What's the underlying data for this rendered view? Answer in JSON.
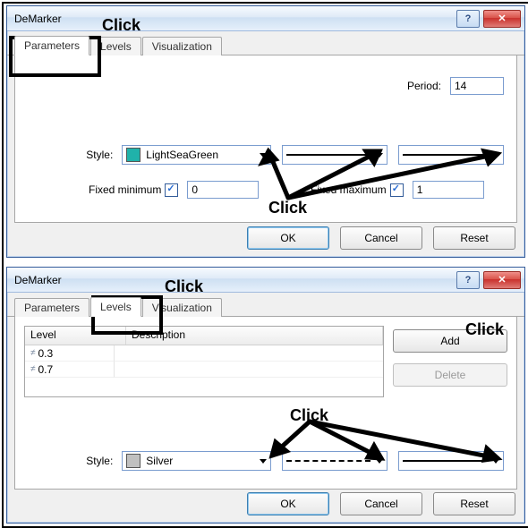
{
  "dialog1": {
    "title": "DeMarker",
    "tabs": {
      "parameters": "Parameters",
      "levels": "Levels",
      "visualization": "Visualization"
    },
    "period_label": "Period:",
    "period_value": "14",
    "style_label": "Style:",
    "style_color_name": "LightSeaGreen",
    "fixed_min_label": "Fixed minimum",
    "fixed_min_value": "0",
    "fixed_max_label": "Fixed maximum",
    "fixed_max_value": "1",
    "buttons": {
      "ok": "OK",
      "cancel": "Cancel",
      "reset": "Reset"
    }
  },
  "dialog2": {
    "title": "DeMarker",
    "tabs": {
      "parameters": "Parameters",
      "levels": "Levels",
      "visualization": "Visualization"
    },
    "table": {
      "col_level": "Level",
      "col_desc": "Description",
      "rows": [
        {
          "level": "0.3",
          "desc": ""
        },
        {
          "level": "0.7",
          "desc": ""
        }
      ]
    },
    "add": "Add",
    "delete": "Delete",
    "style_label": "Style:",
    "style_color_name": "Silver",
    "buttons": {
      "ok": "OK",
      "cancel": "Cancel",
      "reset": "Reset"
    }
  },
  "annotations": {
    "click": "Click"
  }
}
